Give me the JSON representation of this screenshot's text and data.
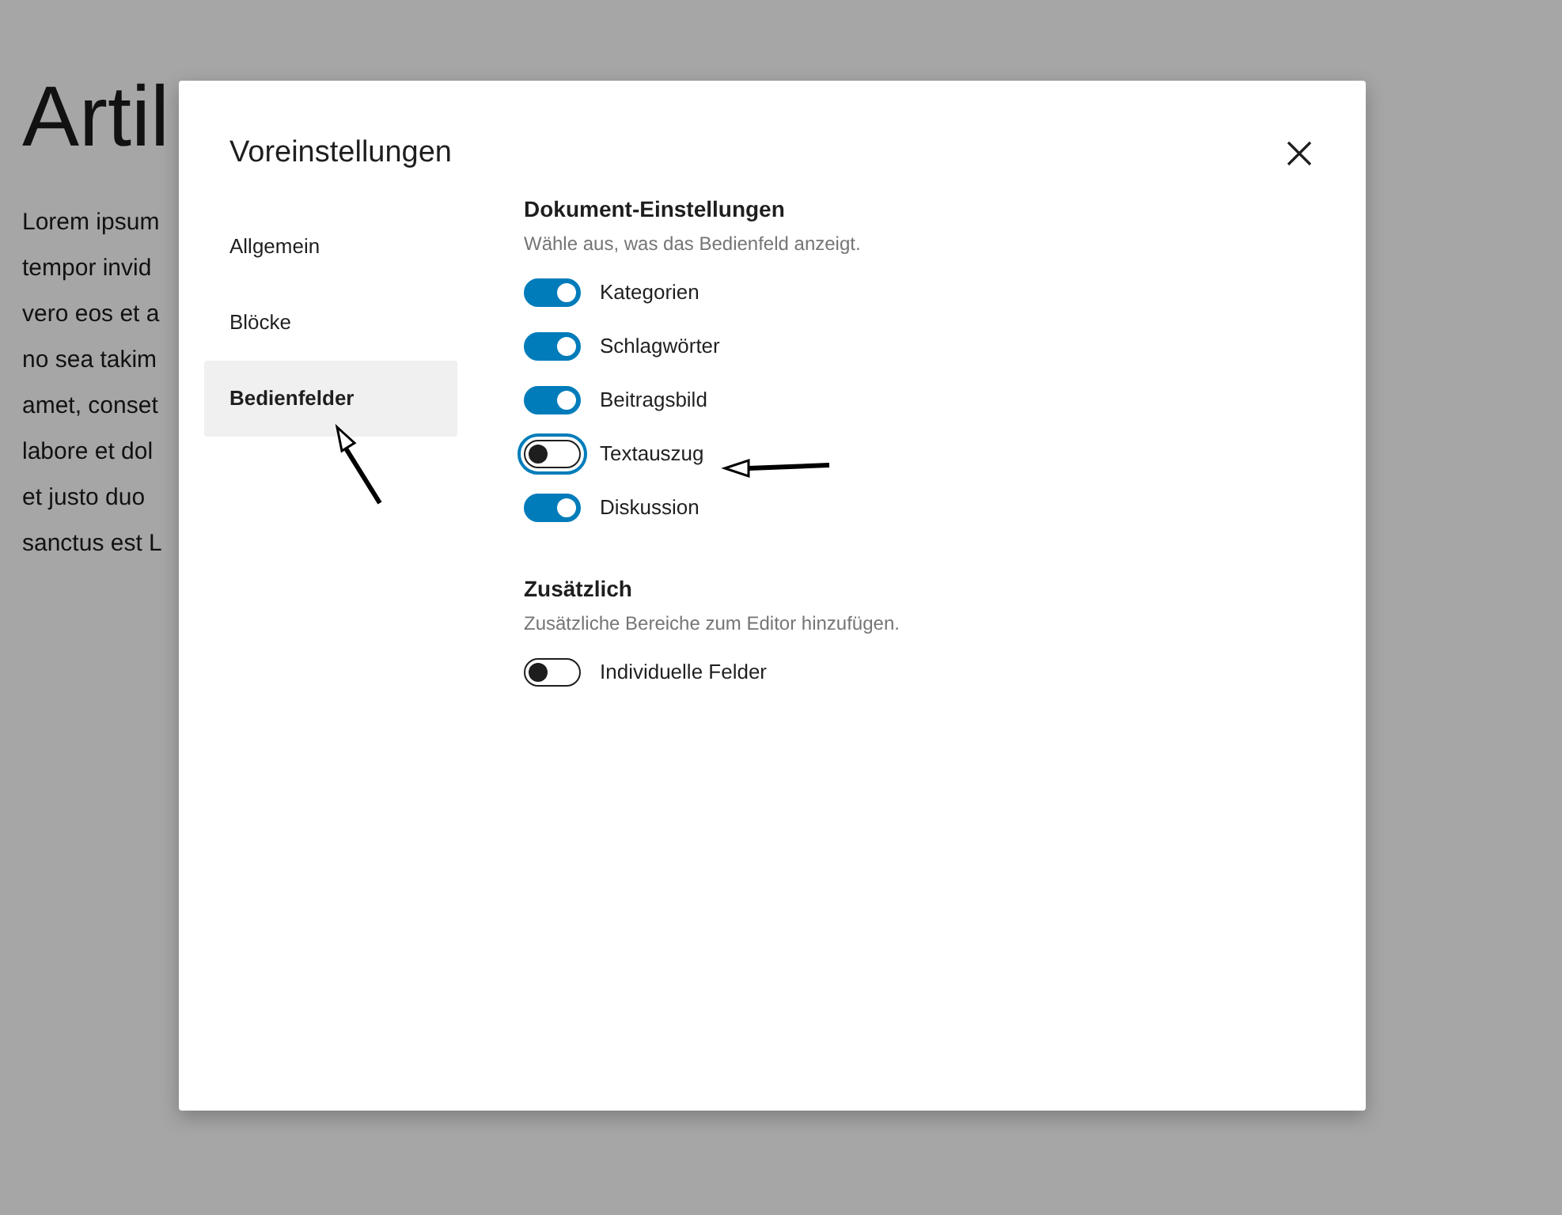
{
  "background": {
    "heading": "Artil",
    "lines": [
      "Lorem ipsum",
      "tempor invid",
      "vero eos et a",
      "no sea takim",
      "amet, conset",
      "labore et dol",
      "et justo duo",
      "sanctus est L"
    ]
  },
  "dialog": {
    "title": "Voreinstellungen",
    "sidebar": {
      "items": [
        {
          "label": "Allgemein",
          "selected": false
        },
        {
          "label": "Blöcke",
          "selected": false
        },
        {
          "label": "Bedienfelder",
          "selected": true
        }
      ]
    },
    "sections": [
      {
        "title": "Dokument-Einstellungen",
        "description": "Wähle aus, was das Bedienfeld anzeigt.",
        "options": [
          {
            "label": "Kategorien",
            "on": true,
            "focused": false
          },
          {
            "label": "Schlagwörter",
            "on": true,
            "focused": false
          },
          {
            "label": "Beitragsbild",
            "on": true,
            "focused": false
          },
          {
            "label": "Textauszug",
            "on": false,
            "focused": true
          },
          {
            "label": "Diskussion",
            "on": true,
            "focused": false
          }
        ]
      },
      {
        "title": "Zusätzlich",
        "description": "Zusätzliche Bereiche zum Editor hinzufügen.",
        "options": [
          {
            "label": "Individuelle Felder",
            "on": false,
            "focused": false
          }
        ]
      }
    ]
  }
}
